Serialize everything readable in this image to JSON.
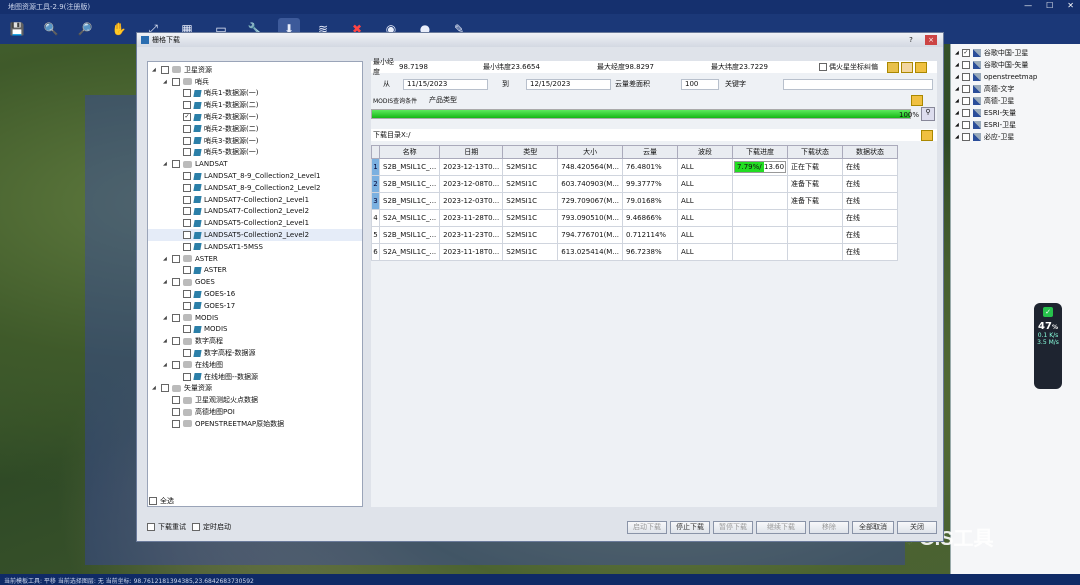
{
  "app": {
    "title": "地图资源工具-2.9(注册版)"
  },
  "status_bar": "当前模板工具: 平移  当前选择图层: 无  当前坐标: 98.7612181394385,23.6842683730592",
  "dialog": {
    "title": "栅格下载",
    "help": "?",
    "close": "×"
  },
  "tree": [
    {
      "level": 0,
      "label": "卫星资源",
      "expanded": true,
      "icon": "db",
      "checked": false
    },
    {
      "level": 1,
      "label": "哨兵",
      "expanded": true,
      "icon": "db",
      "checked": false
    },
    {
      "level": 2,
      "label": "哨兵1-数据源(一)",
      "icon": "tile",
      "checked": false
    },
    {
      "level": 2,
      "label": "哨兵1-数据源(二)",
      "icon": "tile",
      "checked": false
    },
    {
      "level": 2,
      "label": "哨兵2-数据源(一)",
      "icon": "tile",
      "checked": true
    },
    {
      "level": 2,
      "label": "哨兵2-数据源(二)",
      "icon": "tile",
      "checked": false
    },
    {
      "level": 2,
      "label": "哨兵3-数据源(一)",
      "icon": "tile",
      "checked": false
    },
    {
      "level": 2,
      "label": "哨兵5-数据源(一)",
      "icon": "tile",
      "checked": false
    },
    {
      "level": 1,
      "label": "LANDSAT",
      "expanded": true,
      "icon": "db",
      "checked": false
    },
    {
      "level": 2,
      "label": "LANDSAT_8-9_Collection2_Level1",
      "icon": "tile",
      "checked": false
    },
    {
      "level": 2,
      "label": "LANDSAT_8-9_Collection2_Level2",
      "icon": "tile",
      "checked": false
    },
    {
      "level": 2,
      "label": "LANDSAT7-Collection2_Level1",
      "icon": "tile",
      "checked": false
    },
    {
      "level": 2,
      "label": "LANDSAT7-Collection2_Level2",
      "icon": "tile",
      "checked": false
    },
    {
      "level": 2,
      "label": "LANDSAT5-Collection2_Level1",
      "icon": "tile",
      "checked": false
    },
    {
      "level": 2,
      "label": "LANDSAT5-Collection2_Level2",
      "icon": "tile",
      "checked": false,
      "selected": true
    },
    {
      "level": 2,
      "label": "LANDSAT1-5MSS",
      "icon": "tile",
      "checked": false
    },
    {
      "level": 1,
      "label": "ASTER",
      "expanded": true,
      "icon": "db",
      "checked": false
    },
    {
      "level": 2,
      "label": "ASTER",
      "icon": "tile",
      "checked": false
    },
    {
      "level": 1,
      "label": "GOES",
      "expanded": true,
      "icon": "db",
      "checked": false
    },
    {
      "level": 2,
      "label": "GOES-16",
      "icon": "tile",
      "checked": false
    },
    {
      "level": 2,
      "label": "GOES-17",
      "icon": "tile",
      "checked": false
    },
    {
      "level": 1,
      "label": "MODIS",
      "expanded": true,
      "icon": "db",
      "checked": false
    },
    {
      "level": 2,
      "label": "MODIS",
      "icon": "tile",
      "checked": false
    },
    {
      "level": 1,
      "label": "数字高程",
      "expanded": true,
      "icon": "db",
      "checked": false
    },
    {
      "level": 2,
      "label": "数字高程-数据源",
      "icon": "tile",
      "checked": false
    },
    {
      "level": 1,
      "label": "在线地图",
      "expanded": true,
      "icon": "db",
      "checked": false
    },
    {
      "level": 2,
      "label": "在线地图--数据源",
      "icon": "tile",
      "checked": false
    },
    {
      "level": 0,
      "label": "矢量资源",
      "expanded": true,
      "icon": "db",
      "checked": false
    },
    {
      "level": 1,
      "label": "卫星观测起火点数据",
      "icon": "db",
      "checked": false
    },
    {
      "level": 1,
      "label": "高德地图POI",
      "icon": "db",
      "checked": false
    },
    {
      "level": 1,
      "label": "OPENSTREETMAP原始数据",
      "icon": "db",
      "checked": false
    }
  ],
  "select_all": "全选",
  "query": {
    "min_lon_label": "最小经度",
    "min_lon": "98.7198",
    "min_lat_label": "最小纬度",
    "min_lat": "23.6654",
    "max_lon_label": "最大经度",
    "max_lon": "98.8297",
    "max_lat_label": "最大纬度",
    "max_lat": "23.7229",
    "mars_coord": "偶火星坐标纠偏",
    "from_label": "从",
    "from": "11/15/2023",
    "to_label": "到",
    "to": "12/15/2023",
    "cloud_label": "云量差面积",
    "cloud": "100",
    "keyword_label": "关键字",
    "keyword": "",
    "modis_label": "MODIS查询条件",
    "product_label": "产品类型",
    "progress_pct": 100,
    "progress_text": "100%",
    "dir_label": "下载目录",
    "dir": "X:/"
  },
  "table": {
    "headers": [
      "名称",
      "日期",
      "类型",
      "大小",
      "云量",
      "波段",
      "下载进度",
      "下载状态",
      "数据状态"
    ],
    "rows": [
      {
        "n": "1",
        "sel": true,
        "name": "S2B_MSIL1C_...",
        "date": "2023-12-13T0...",
        "type": "S2MSI1C",
        "size": "748.420564(M...",
        "cloud": "76.4801%",
        "band": "ALL",
        "prog": "7.79%/",
        "prog2": "13.60",
        "status": "正在下载",
        "data": "在线",
        "active": true
      },
      {
        "n": "2",
        "sel": true,
        "name": "S2B_MSIL1C_...",
        "date": "2023-12-08T0...",
        "type": "S2MSI1C",
        "size": "603.740903(M...",
        "cloud": "99.3777%",
        "band": "ALL",
        "prog": "",
        "prog2": "",
        "status": "准备下载",
        "data": "在线"
      },
      {
        "n": "3",
        "sel": true,
        "name": "S2B_MSIL1C_...",
        "date": "2023-12-03T0...",
        "type": "S2MSI1C",
        "size": "729.709067(M...",
        "cloud": "79.0168%",
        "band": "ALL",
        "prog": "",
        "prog2": "",
        "status": "准备下载",
        "data": "在线"
      },
      {
        "n": "4",
        "sel": false,
        "name": "S2A_MSIL1C_...",
        "date": "2023-11-28T0...",
        "type": "S2MSI1C",
        "size": "793.090510(M...",
        "cloud": "9.46866%",
        "band": "ALL",
        "prog": "",
        "prog2": "",
        "status": "",
        "data": "在线"
      },
      {
        "n": "5",
        "sel": false,
        "name": "S2B_MSIL1C_...",
        "date": "2023-11-23T0...",
        "type": "S2MSI1C",
        "size": "794.776701(M...",
        "cloud": "0.712114%",
        "band": "ALL",
        "prog": "",
        "prog2": "",
        "status": "",
        "data": "在线"
      },
      {
        "n": "6",
        "sel": false,
        "name": "S2A_MSIL1C_...",
        "date": "2023-11-18T0...",
        "type": "S2MSI1C",
        "size": "613.025414(M...",
        "cloud": "96.7238%",
        "band": "ALL",
        "prog": "",
        "prog2": "",
        "status": "",
        "data": "在线"
      }
    ]
  },
  "bottom": {
    "retry": "下载重试",
    "timer": "定时启动",
    "start": "启动下载",
    "stop": "停止下载",
    "pause": "暂停下载",
    "resume": "继续下载",
    "remove": "移除",
    "cancel_all": "全部取消",
    "close": "关闭"
  },
  "layers": [
    {
      "label": "谷歌中国-卫星",
      "checked": true
    },
    {
      "label": "谷歌中国-矢量",
      "checked": false
    },
    {
      "label": "openstreetmap",
      "checked": false
    },
    {
      "label": "高德-文字",
      "checked": false
    },
    {
      "label": "高德-卫星",
      "checked": false
    },
    {
      "label": "ESRI-矢量",
      "checked": false
    },
    {
      "label": "ESRI-卫星",
      "checked": false
    },
    {
      "label": "必应-卫星",
      "checked": false
    }
  ],
  "speed": {
    "pct": "47",
    "unit": "%",
    "up": "0.1",
    "up_unit": "K/s",
    "down": "3.5",
    "down_unit": "M/s"
  },
  "watermark": "GIS工具",
  "icons": [
    "save-icon",
    "zoom-in-icon",
    "zoom-out-icon",
    "pan-icon",
    "move-icon",
    "grid-icon",
    "clear-icon",
    "wrench-icon",
    "download-icon",
    "layers-icon",
    "delete-icon",
    "globe-icon",
    "user-icon",
    "pencil-icon"
  ]
}
